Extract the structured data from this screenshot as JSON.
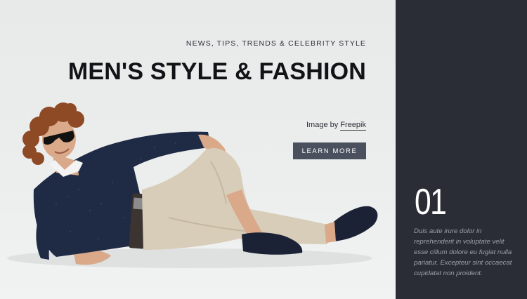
{
  "hero": {
    "eyebrow": "NEWS, TIPS, TRENDS & CELEBRITY STYLE",
    "title": "MEN'S STYLE & FASHION",
    "credit_prefix": "Image by",
    "credit_link": "Freepik",
    "cta_label": "LEARN MORE",
    "image_alt": "Man with curly hair and sunglasses reclining on the floor"
  },
  "feature": {
    "number": "01",
    "description": "Duis aute irure dolor in reprehenderit in voluptate velit esse cillum dolore eu fugiat nulla pariatur. Excepteur sint occaecat cupidatat non proident."
  },
  "colors": {
    "panel": "#2a2d36",
    "button": "#4a505e",
    "background": "#eceeee"
  }
}
